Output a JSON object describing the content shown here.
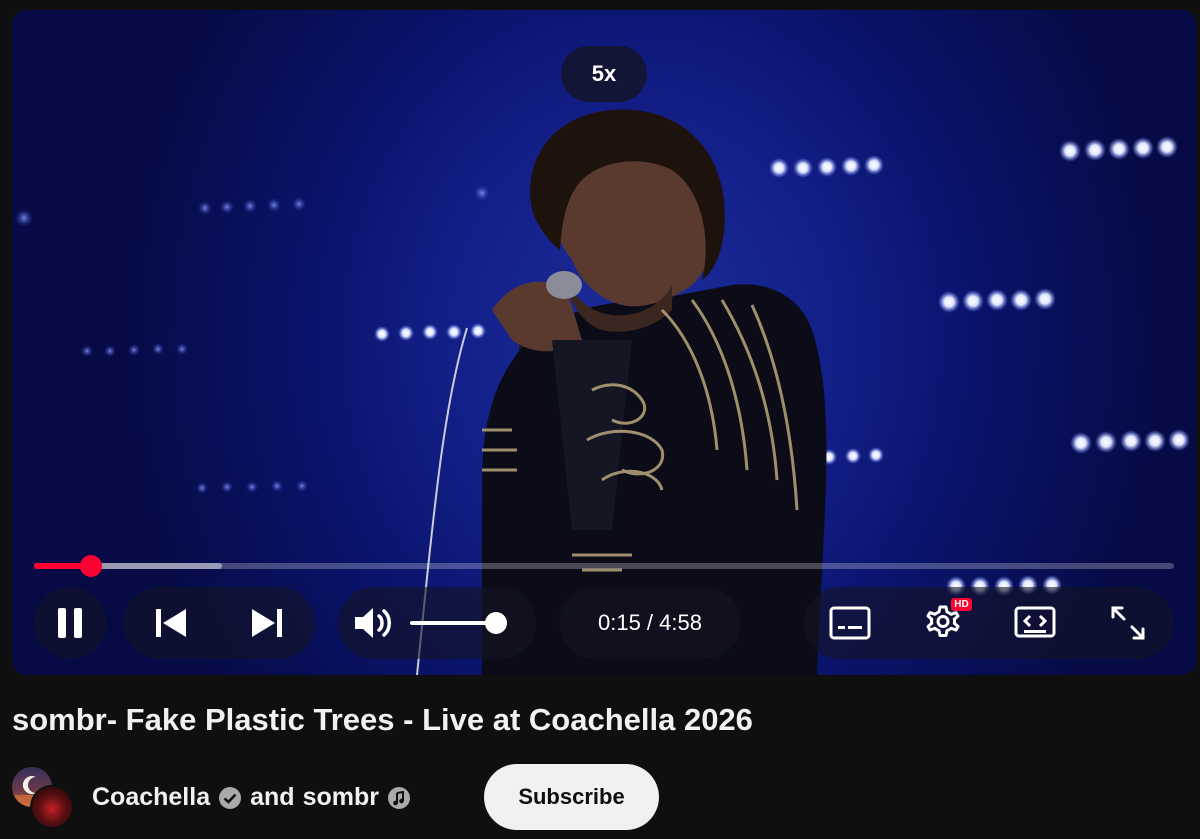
{
  "player": {
    "speed_indicator": "5x",
    "time_display": "0:15 / 4:58",
    "current_time": "0:15",
    "duration": "4:58",
    "progress_fraction": 0.05,
    "buffered_fraction": 0.165,
    "volume_fraction": 1.0,
    "quality_badge": "HD",
    "accent_color": "#ff0033",
    "icons": [
      "pause-icon",
      "previous-icon",
      "next-icon",
      "volume-icon",
      "subtitles-icon",
      "settings-icon",
      "miniplayer-icon",
      "fullscreen-icon"
    ]
  },
  "video": {
    "title": "sombr- Fake Plastic Trees - Live at Coachella 2026"
  },
  "channel": {
    "name_primary": "Coachella",
    "joiner": "and",
    "name_secondary": "sombr",
    "verified_icon": "verified-check-icon",
    "artist_icon": "music-note-badge-icon"
  },
  "actions": {
    "subscribe_label": "Subscribe"
  }
}
